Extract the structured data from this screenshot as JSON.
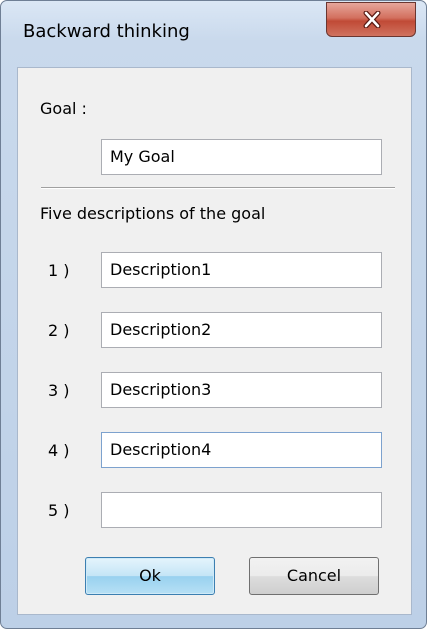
{
  "window": {
    "title": "Backward thinking",
    "close_icon": "close-icon"
  },
  "goal": {
    "label": "Goal :",
    "value": "My Goal"
  },
  "descriptions": {
    "heading": "Five descriptions of the goal",
    "items": [
      {
        "number": "1 )",
        "value": "Description1"
      },
      {
        "number": "2 )",
        "value": "Description2"
      },
      {
        "number": "3 )",
        "value": "Description3"
      },
      {
        "number": "4 )",
        "value": "Description4"
      },
      {
        "number": "5 )",
        "value": ""
      }
    ]
  },
  "buttons": {
    "ok_label": "Ok",
    "cancel_label": "Cancel"
  }
}
